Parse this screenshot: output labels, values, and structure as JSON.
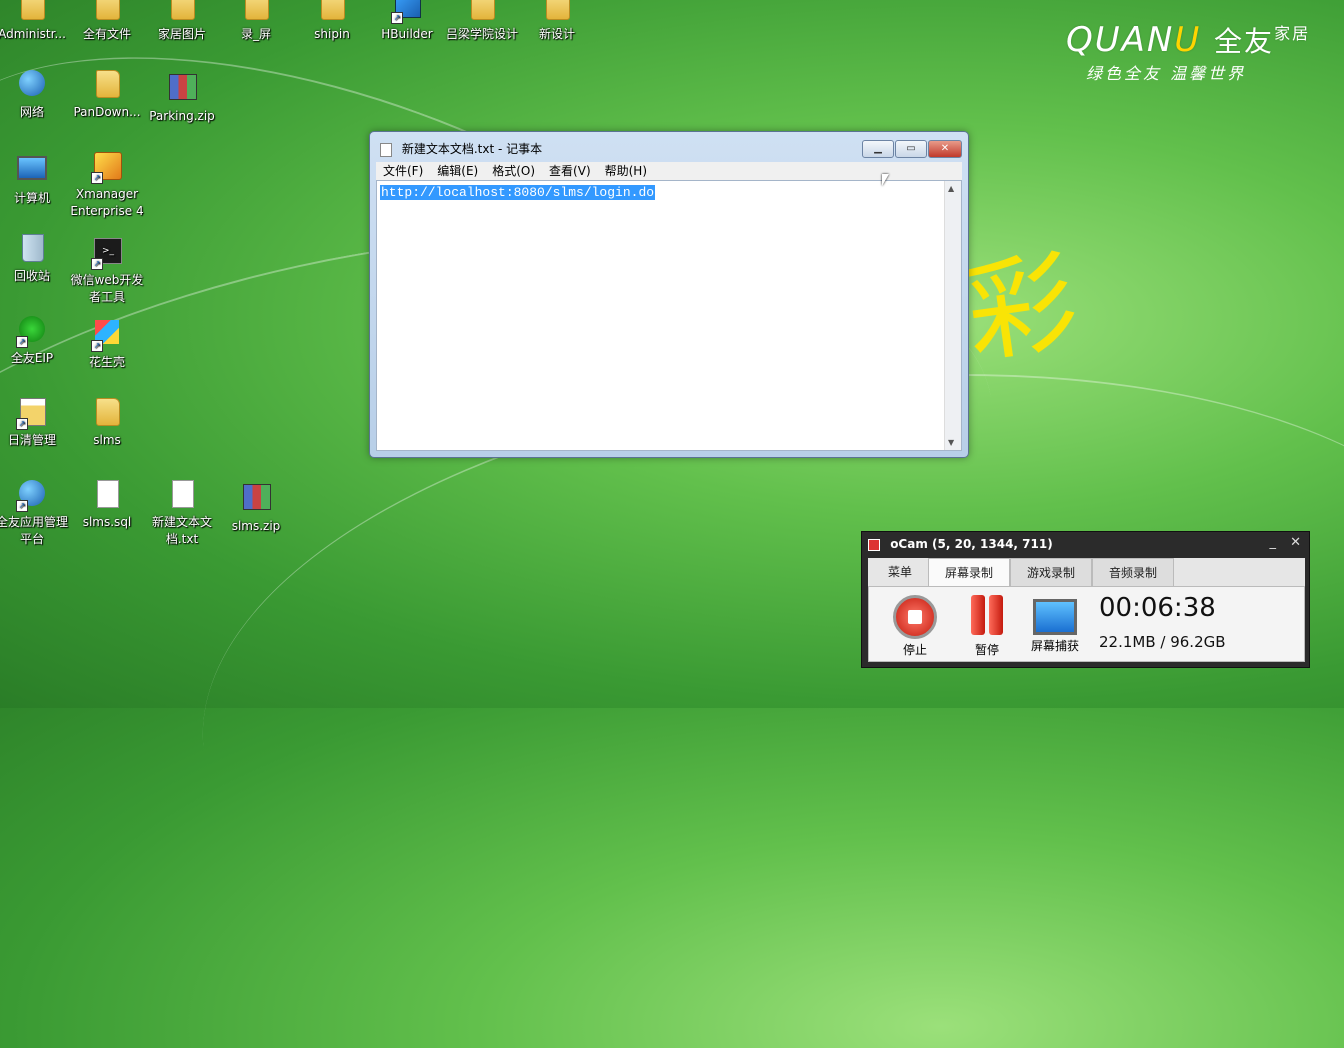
{
  "desktop": {
    "icons": [
      {
        "label": "Administr..."
      },
      {
        "label": "全有文件"
      },
      {
        "label": "家居图片"
      },
      {
        "label": "录_屏"
      },
      {
        "label": "shipin"
      },
      {
        "label": "HBuilder"
      },
      {
        "label": "吕梁学院设计"
      },
      {
        "label": "新设计"
      },
      {
        "label": "网络"
      },
      {
        "label": "PanDown..."
      },
      {
        "label": "Parking.zip"
      },
      {
        "label": "计算机"
      },
      {
        "label": "Xmanager Enterprise 4"
      },
      {
        "label": "回收站"
      },
      {
        "label": "微信web开发者工具"
      },
      {
        "label": "全友EIP"
      },
      {
        "label": "花生壳"
      },
      {
        "label": "日清管理"
      },
      {
        "label": "slms"
      },
      {
        "label": "全友应用管理平台"
      },
      {
        "label": "slms.sql"
      },
      {
        "label": "新建文本文档.txt"
      },
      {
        "label": "slms.zip"
      }
    ]
  },
  "brand": {
    "logo_a": "QUAN",
    "logo_u": "U",
    "logo_cn": "全友",
    "logo_small": "家居",
    "slogan": "绿色全友 温馨世界"
  },
  "notepad": {
    "title": "新建文本文档.txt - 记事本",
    "menu": [
      "文件(F)",
      "编辑(E)",
      "格式(O)",
      "查看(V)",
      "帮助(H)"
    ],
    "content": "http://localhost:8080/slms/login.do"
  },
  "ocam": {
    "title": "oCam (5, 20, 1344, 711)",
    "tabs": [
      "菜单",
      "屏幕录制",
      "游戏录制",
      "音频录制"
    ],
    "stop_label": "停止",
    "pause_label": "暂停",
    "capture_label": "屏幕捕获",
    "time": "00:06:38",
    "size": "22.1MB / 96.2GB"
  },
  "colors": {
    "selection": "#3399ff",
    "brand_accent": "#ffd400"
  }
}
